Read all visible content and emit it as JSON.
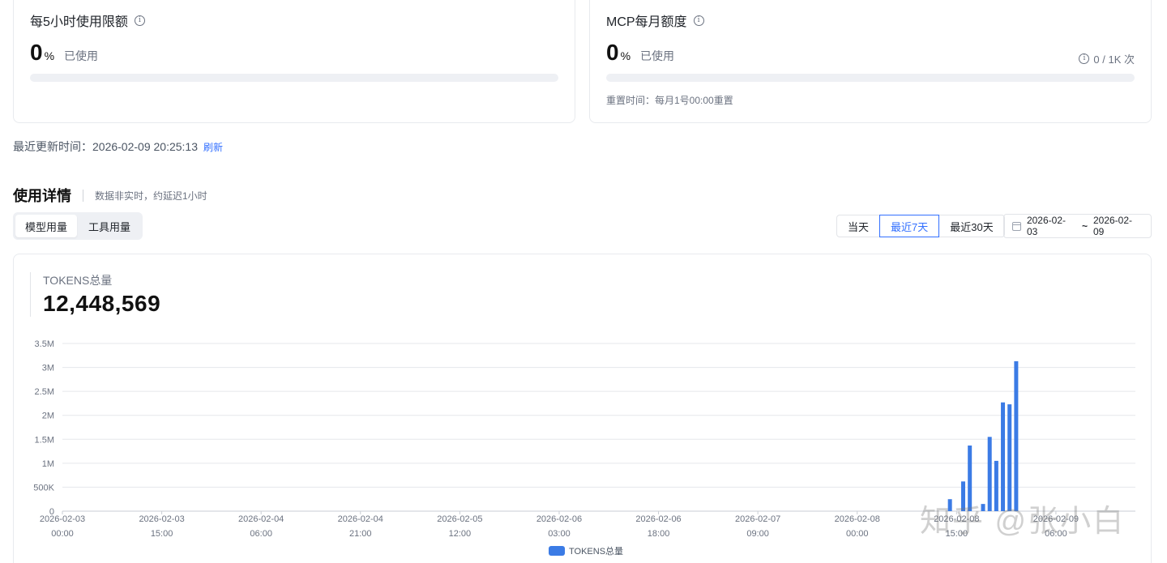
{
  "quota_cards": [
    {
      "title": "每5小时使用限额",
      "percent": "0",
      "unit": "%",
      "used_label": "已使用",
      "progress": 0
    },
    {
      "title": "MCP每月额度",
      "percent": "0",
      "unit": "%",
      "used_label": "已使用",
      "progress": 0,
      "usage_count": "0 / 1K 次",
      "reset_note": "重置时间：每月1号00:00重置"
    }
  ],
  "update": {
    "label": "最近更新时间：",
    "time": "2026-02-09 20:25:13",
    "refresh": "刷新"
  },
  "section": {
    "title": "使用详情",
    "subtitle": "数据非实时，约延迟1小时"
  },
  "tabs": [
    {
      "label": "模型用量",
      "active": true
    },
    {
      "label": "工具用量",
      "active": false
    }
  ],
  "ranges": [
    {
      "label": "当天",
      "active": false
    },
    {
      "label": "最近7天",
      "active": true
    },
    {
      "label": "最近30天",
      "active": false
    }
  ],
  "date_range": {
    "start": "2026-02-03",
    "sep": "~",
    "end": "2026-02-09"
  },
  "total": {
    "label": "TOKENS总量",
    "value": "12,448,569"
  },
  "colors": {
    "accent": "#3370ff",
    "bar": "#3b7be5",
    "grid": "#e5e7eb"
  },
  "chart_data": {
    "type": "bar",
    "ylim": [
      0,
      3500000
    ],
    "yticks": [
      0,
      500000,
      1000000,
      1500000,
      2000000,
      2500000,
      3000000,
      3500000
    ],
    "ytick_labels": [
      "0",
      "500K",
      "1M",
      "1.5M",
      "2M",
      "2.5M",
      "3M",
      "3.5M"
    ],
    "xlim": [
      0,
      162
    ],
    "xticks": [
      {
        "at": 0,
        "label": [
          "2026-02-03",
          "00:00"
        ]
      },
      {
        "at": 15,
        "label": [
          "2026-02-03",
          "15:00"
        ]
      },
      {
        "at": 30,
        "label": [
          "2026-02-04",
          "06:00"
        ]
      },
      {
        "at": 45,
        "label": [
          "2026-02-04",
          "21:00"
        ]
      },
      {
        "at": 60,
        "label": [
          "2026-02-05",
          "12:00"
        ]
      },
      {
        "at": 75,
        "label": [
          "2026-02-06",
          "03:00"
        ]
      },
      {
        "at": 90,
        "label": [
          "2026-02-06",
          "18:00"
        ]
      },
      {
        "at": 105,
        "label": [
          "2026-02-07",
          "09:00"
        ]
      },
      {
        "at": 120,
        "label": [
          "2026-02-08",
          "00:00"
        ]
      },
      {
        "at": 135,
        "label": [
          "2026-02-08",
          "15:00"
        ]
      },
      {
        "at": 150,
        "label": [
          "2026-02-09",
          "06:00"
        ]
      }
    ],
    "series": [
      {
        "name": "TOKENS总量",
        "points": [
          {
            "x": 134,
            "y": 250000
          },
          {
            "x": 136,
            "y": 620000
          },
          {
            "x": 137,
            "y": 1370000
          },
          {
            "x": 139,
            "y": 150000
          },
          {
            "x": 140,
            "y": 1550000
          },
          {
            "x": 141,
            "y": 1050000
          },
          {
            "x": 142,
            "y": 2270000
          },
          {
            "x": 143,
            "y": 2230000
          },
          {
            "x": 144,
            "y": 3130000
          }
        ]
      }
    ]
  },
  "watermark": "知乎 @张小白"
}
